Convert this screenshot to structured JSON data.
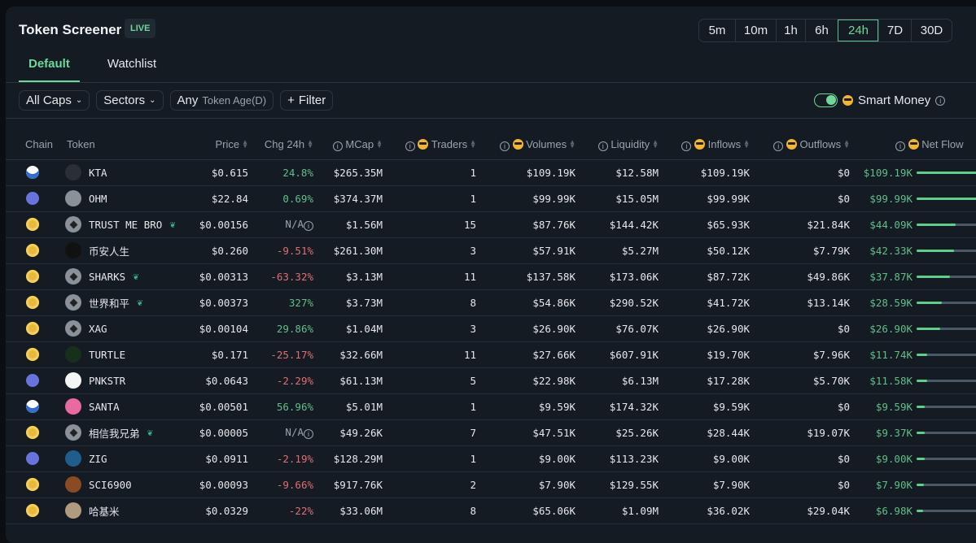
{
  "header": {
    "title": "Token Screener",
    "live": "LIVE"
  },
  "timeframes": [
    {
      "label": "5m",
      "w": 44
    },
    {
      "label": "10m",
      "w": 50
    },
    {
      "label": "1h",
      "w": 36
    },
    {
      "label": "6h",
      "w": 40
    },
    {
      "label": "24h",
      "w": 50
    },
    {
      "label": "7D",
      "w": 40
    },
    {
      "label": "30D",
      "w": 50
    }
  ],
  "active_timeframe": "24h",
  "tabs": [
    "Default",
    "Watchlist"
  ],
  "filters": {
    "caps": "All Caps",
    "sectors": "Sectors",
    "age_value": "Any",
    "age_label": "Token Age(D)",
    "filter": "Filter"
  },
  "smart_money": {
    "label": "Smart Money",
    "enabled": true
  },
  "columns": {
    "chain": "Chain",
    "token": "Token",
    "price": "Price",
    "chg": "Chg 24h",
    "mcap": "MCap",
    "traders": "Traders",
    "volumes": "Volumes",
    "liquidity": "Liquidity",
    "inflows": "Inflows",
    "outflows": "Outflows",
    "netflow": "Net Flow"
  },
  "rows": [
    {
      "chain": "sol",
      "token": "KTA",
      "new": false,
      "price": "$0.615",
      "chg": "24.8%",
      "mcap": "$265.35M",
      "traders": "1",
      "volumes": "$109.19K",
      "liquidity": "$12.58M",
      "inflows": "$109.19K",
      "outflows": "$0",
      "netflow": "$109.19K",
      "nf": 109.19
    },
    {
      "chain": "eth",
      "token": "OHM",
      "new": false,
      "price": "$22.84",
      "chg": "0.69%",
      "mcap": "$374.37M",
      "traders": "1",
      "volumes": "$99.99K",
      "liquidity": "$15.05M",
      "inflows": "$99.99K",
      "outflows": "$0",
      "netflow": "$99.99K",
      "nf": 99.99
    },
    {
      "chain": "bnb",
      "token": "TRUST ME BRO",
      "new": true,
      "price": "$0.00156",
      "chg": "N/A",
      "mcap": "$1.56M",
      "traders": "15",
      "volumes": "$87.76K",
      "liquidity": "$144.42K",
      "inflows": "$65.93K",
      "outflows": "$21.84K",
      "netflow": "$44.09K",
      "nf": 44.09
    },
    {
      "chain": "bnb",
      "token": "币安人生",
      "new": false,
      "price": "$0.260",
      "chg": "-9.51%",
      "mcap": "$261.30M",
      "traders": "3",
      "volumes": "$57.91K",
      "liquidity": "$5.27M",
      "inflows": "$50.12K",
      "outflows": "$7.79K",
      "netflow": "$42.33K",
      "nf": 42.33
    },
    {
      "chain": "bnb",
      "token": "SHARKS",
      "new": true,
      "price": "$0.00313",
      "chg": "-63.32%",
      "mcap": "$3.13M",
      "traders": "11",
      "volumes": "$137.58K",
      "liquidity": "$173.06K",
      "inflows": "$87.72K",
      "outflows": "$49.86K",
      "netflow": "$37.87K",
      "nf": 37.87
    },
    {
      "chain": "bnb",
      "token": "世界和平",
      "new": true,
      "price": "$0.00373",
      "chg": "327%",
      "mcap": "$3.73M",
      "traders": "8",
      "volumes": "$54.86K",
      "liquidity": "$290.52K",
      "inflows": "$41.72K",
      "outflows": "$13.14K",
      "netflow": "$28.59K",
      "nf": 28.59
    },
    {
      "chain": "bnb",
      "token": "XAG",
      "new": false,
      "price": "$0.00104",
      "chg": "29.86%",
      "mcap": "$1.04M",
      "traders": "3",
      "volumes": "$26.90K",
      "liquidity": "$76.07K",
      "inflows": "$26.90K",
      "outflows": "$0",
      "netflow": "$26.90K",
      "nf": 26.9
    },
    {
      "chain": "bnb",
      "token": "TURTLE",
      "new": false,
      "price": "$0.171",
      "chg": "-25.17%",
      "mcap": "$32.66M",
      "traders": "11",
      "volumes": "$27.66K",
      "liquidity": "$607.91K",
      "inflows": "$19.70K",
      "outflows": "$7.96K",
      "netflow": "$11.74K",
      "nf": 11.74
    },
    {
      "chain": "eth",
      "token": "PNKSTR",
      "new": false,
      "price": "$0.0643",
      "chg": "-2.29%",
      "mcap": "$61.13M",
      "traders": "5",
      "volumes": "$22.98K",
      "liquidity": "$6.13M",
      "inflows": "$17.28K",
      "outflows": "$5.70K",
      "netflow": "$11.58K",
      "nf": 11.58
    },
    {
      "chain": "sol",
      "token": "SANTA",
      "new": false,
      "price": "$0.00501",
      "chg": "56.96%",
      "mcap": "$5.01M",
      "traders": "1",
      "volumes": "$9.59K",
      "liquidity": "$174.32K",
      "inflows": "$9.59K",
      "outflows": "$0",
      "netflow": "$9.59K",
      "nf": 9.59
    },
    {
      "chain": "bnb",
      "token": "相信我兄弟",
      "new": true,
      "price": "$0.00005",
      "chg": "N/A",
      "mcap": "$49.26K",
      "traders": "7",
      "volumes": "$47.51K",
      "liquidity": "$25.26K",
      "inflows": "$28.44K",
      "outflows": "$19.07K",
      "netflow": "$9.37K",
      "nf": 9.37
    },
    {
      "chain": "eth",
      "token": "ZIG",
      "new": false,
      "price": "$0.0911",
      "chg": "-2.19%",
      "mcap": "$128.29M",
      "traders": "1",
      "volumes": "$9.00K",
      "liquidity": "$113.23K",
      "inflows": "$9.00K",
      "outflows": "$0",
      "netflow": "$9.00K",
      "nf": 9.0
    },
    {
      "chain": "bnb",
      "token": "SCI6900",
      "new": false,
      "price": "$0.00093",
      "chg": "-9.66%",
      "mcap": "$917.76K",
      "traders": "2",
      "volumes": "$7.90K",
      "liquidity": "$129.55K",
      "inflows": "$7.90K",
      "outflows": "$0",
      "netflow": "$7.90K",
      "nf": 7.9
    },
    {
      "chain": "bnb",
      "token": "哈基米",
      "new": false,
      "price": "$0.0329",
      "chg": "-22%",
      "mcap": "$33.06M",
      "traders": "8",
      "volumes": "$65.06K",
      "liquidity": "$1.09M",
      "inflows": "$36.02K",
      "outflows": "$29.04K",
      "netflow": "$6.98K",
      "nf": 6.98
    }
  ],
  "token_icon_colors": {
    "KTA": "#2a2f35",
    "OHM": "#8b9199",
    "币安人生": "#111",
    "TURTLE": "#17301c",
    "PNKSTR": "#f4f4f4",
    "SANTA": "#e86aa0",
    "ZIG": "#1f5e8c",
    "SCI6900": "#8a4a22",
    "哈基米": "#b09a80"
  }
}
